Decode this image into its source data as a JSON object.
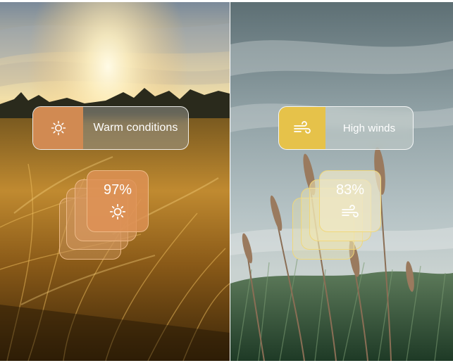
{
  "panels": [
    {
      "condition_label": "Warm conditions",
      "icon": "sun-icon",
      "value": "97%",
      "accent": "#d18a52"
    },
    {
      "condition_label": "High winds",
      "icon": "wind-icon",
      "value": "83%",
      "accent": "#e6c24a"
    }
  ]
}
